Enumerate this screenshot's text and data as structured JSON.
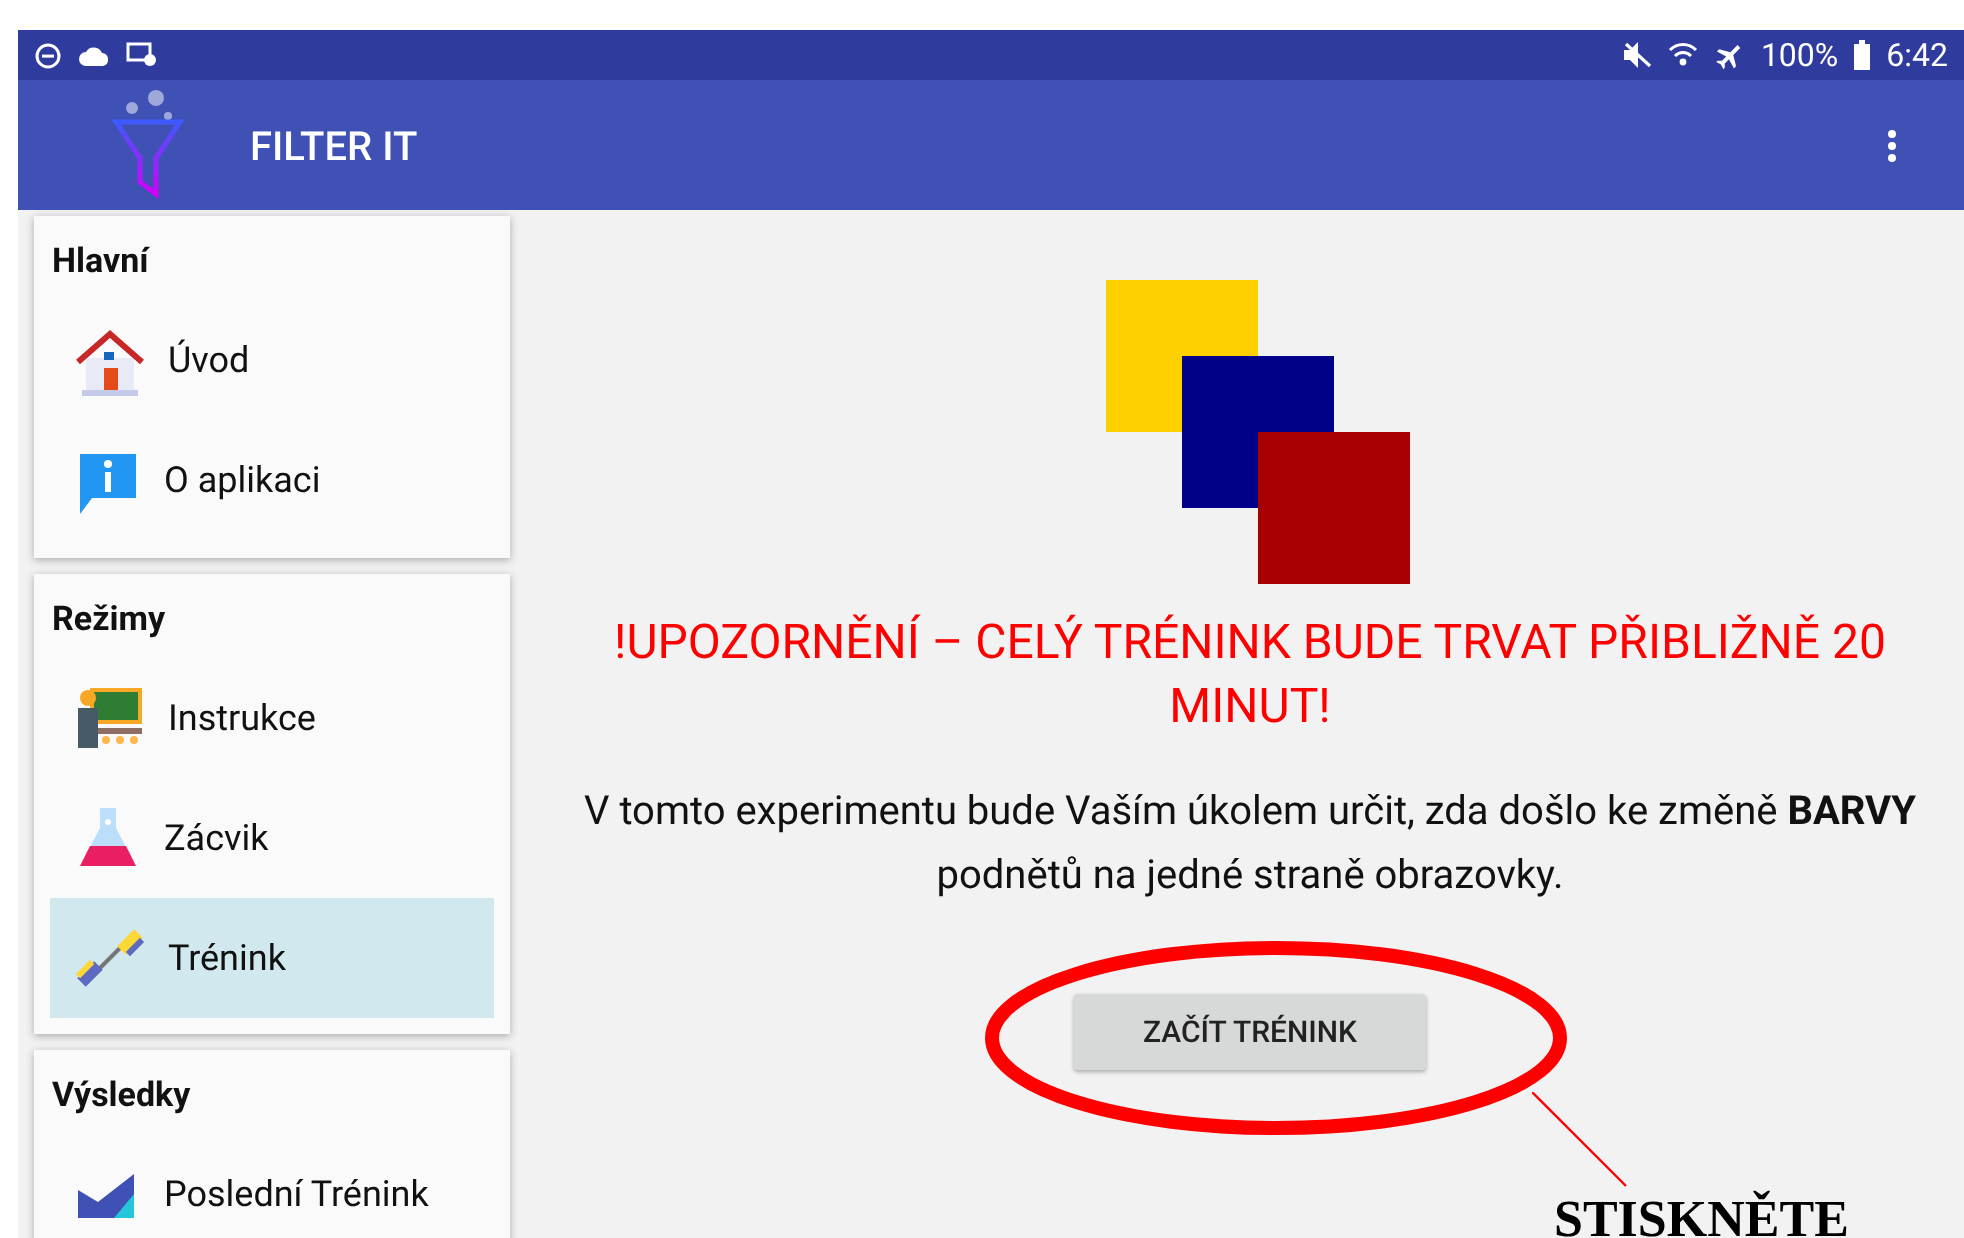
{
  "status_bar": {
    "battery": "100%",
    "time": "6:42"
  },
  "app_bar": {
    "title": "FILTER IT"
  },
  "sidebar": {
    "sections": [
      {
        "title": "Hlavní",
        "items": [
          {
            "label": "Úvod",
            "kind": "home",
            "selected": false
          },
          {
            "label": "O aplikaci",
            "kind": "info",
            "selected": false
          }
        ]
      },
      {
        "title": "Režimy",
        "items": [
          {
            "label": "Instrukce",
            "kind": "teacher",
            "selected": false
          },
          {
            "label": "Zácvik",
            "kind": "flask",
            "selected": false
          },
          {
            "label": "Trénink",
            "kind": "dumbbell",
            "selected": true
          }
        ]
      },
      {
        "title": "Výsledky",
        "items": [
          {
            "label": "Poslední Trénink",
            "kind": "chart",
            "selected": false
          }
        ]
      }
    ]
  },
  "content": {
    "warning": "!UPOZORNĚNÍ – CELÝ TRÉNINK BUDE TRVAT PŘIBLIŽNĚ 20 MINUT!",
    "description": "V tomto experimentu bude Vaším úkolem určit, zda došlo ke změně **BARVY** podnětů na jedné straně obrazovky.",
    "button": "ZAČÍT TRÉNINK"
  },
  "annotation": {
    "text": "STISKNĚTE"
  }
}
